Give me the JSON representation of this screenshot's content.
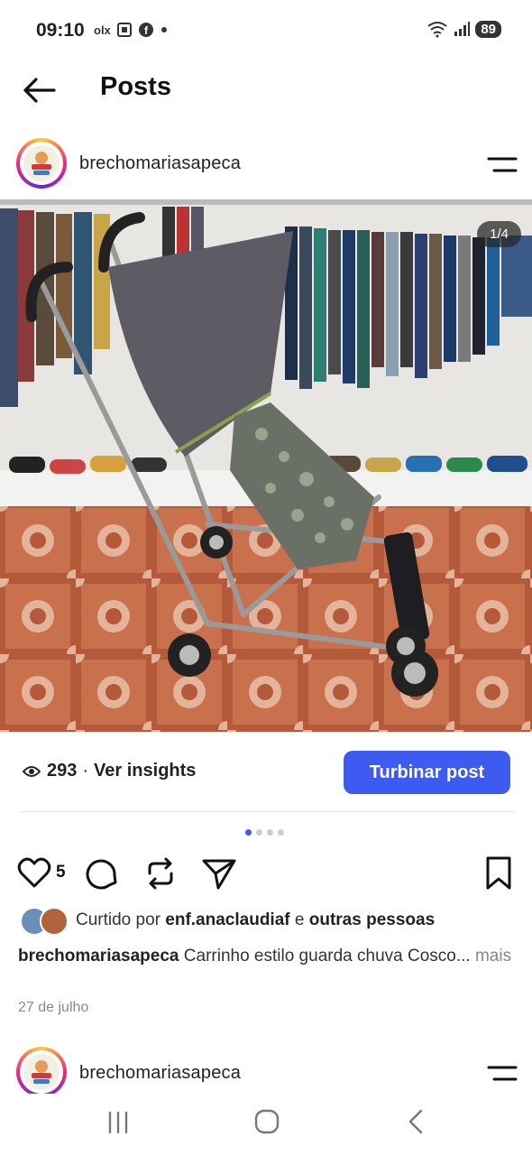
{
  "status_bar": {
    "time": "09:10",
    "apps_text": "olx",
    "battery": "89"
  },
  "header": {
    "title": "Posts"
  },
  "post": {
    "username": "brechomariasapeca",
    "image_counter": "1/4",
    "views_count": "293",
    "views_separator": "·",
    "insights_label": "Ver insights",
    "boost_label": "Turbinar post",
    "likes_count": "5",
    "liked_by_prefix": "Curtido por",
    "liked_by_user": "enf.anaclaudiaf",
    "liked_by_and": "e",
    "liked_by_others": "outras pessoas",
    "caption_user": "brechomariasapeca",
    "caption_text": "Carrinho estilo guarda chuva Cosco...",
    "caption_more": "mais",
    "date": "27 de julho",
    "carousel": {
      "total": 4,
      "active": 1
    }
  },
  "next_post": {
    "username": "brechomariasapeca"
  },
  "colors": {
    "accent": "#3d5af1",
    "text": "#222222",
    "muted": "#888888"
  },
  "icons": [
    "back-arrow-icon",
    "menu-icon",
    "eye-icon",
    "heart-icon",
    "comment-icon",
    "repost-icon",
    "share-icon",
    "bookmark-icon",
    "recent-apps-icon",
    "home-icon",
    "back-nav-icon"
  ]
}
